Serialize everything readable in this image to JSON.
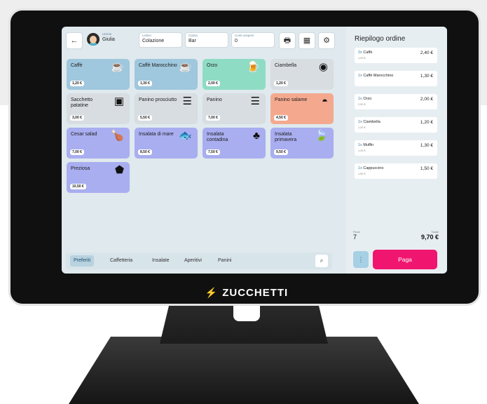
{
  "header": {
    "back_icon": "arrow-left-icon",
    "user": {
      "label": "Utente",
      "value": "Giulia"
    },
    "listino": {
      "label": "Listino",
      "value": "Colazione"
    },
    "cassa": {
      "label": "Cassa",
      "value": "Bar"
    },
    "conti": {
      "label": "Conti sospesi",
      "value": "0"
    },
    "tool_icons": [
      "printer-icon",
      "calculator-icon",
      "gear-icon"
    ],
    "tool_glyphs": [
      "🖶",
      "▦",
      "⚙"
    ]
  },
  "products": [
    {
      "name": "Caffè",
      "price": "1,20 €",
      "icon": "coffee-cup-icon",
      "glyph": "☕",
      "color": "blue"
    },
    {
      "name": "Caffè Marocchino",
      "price": "1,30 €",
      "icon": "coffee-cup-icon",
      "glyph": "☕",
      "color": "blue"
    },
    {
      "name": "Orzo",
      "price": "2,00 €",
      "icon": "mug-icon",
      "glyph": "🍺",
      "color": "green"
    },
    {
      "name": "Ciambella",
      "price": "1,20 €",
      "icon": "donut-icon",
      "glyph": "◉",
      "color": "grey"
    },
    {
      "name": "Sacchetto patatine",
      "price": "3,00 €",
      "icon": "chips-bag-icon",
      "glyph": "▣",
      "color": "grey"
    },
    {
      "name": "Panino prosciutto",
      "price": "5,50 €",
      "icon": "sandwich-icon",
      "glyph": "☰",
      "color": "grey"
    },
    {
      "name": "Panino",
      "price": "7,00 €",
      "icon": "sandwich-icon",
      "glyph": "☰",
      "color": "grey"
    },
    {
      "name": "Panino salame",
      "price": "4,50 €",
      "icon": "taco-icon",
      "glyph": "◓",
      "color": "salmon"
    },
    {
      "name": "Cesar salad",
      "price": "7,00 €",
      "icon": "chicken-leg-icon",
      "glyph": "🍗",
      "color": "purple"
    },
    {
      "name": "Insalata di mare",
      "price": "8,50 €",
      "icon": "fish-icon",
      "glyph": "🐟",
      "color": "purple"
    },
    {
      "name": "Insalata contadina",
      "price": "7,50 €",
      "icon": "broccoli-icon",
      "glyph": "♣",
      "color": "purple"
    },
    {
      "name": "Insalata primavera",
      "price": "9,50 €",
      "icon": "leaf-icon",
      "glyph": "🍃",
      "color": "purple"
    },
    {
      "name": "Preziosa",
      "price": "10,50 €",
      "icon": "vegetable-icon",
      "glyph": "⬟",
      "color": "purple"
    }
  ],
  "categories": {
    "items": [
      "Preferiti",
      "Caffetteria",
      "Insalate",
      "Aperitivi",
      "Panini"
    ],
    "active": "Preferiti",
    "search_icon": "search-icon"
  },
  "order": {
    "title": "Riepilogo ordine",
    "lines": [
      {
        "qty": "2x",
        "name": "Caffè",
        "sub": "1,20 €",
        "price": "2,40 €"
      },
      {
        "qty": "1x",
        "name": "Caffè Marocchino",
        "sub": "",
        "price": "1,30 €"
      },
      {
        "qty": "1x",
        "name": "Orzo",
        "sub": "2,00 €",
        "price": "2,00 €"
      },
      {
        "qty": "1x",
        "name": "Ciambella",
        "sub": "1,20 €",
        "price": "1,20 €"
      },
      {
        "qty": "1x",
        "name": "Muffin",
        "sub": "1,30 €",
        "price": "1,30 €"
      },
      {
        "qty": "1x",
        "name": "Cappuccino",
        "sub": "1,50 €",
        "price": "1,50 €"
      }
    ],
    "pezzi_label": "Pezzi",
    "pezzi_value": "7",
    "totale_label": "Totale",
    "totale_value": "9,70 €",
    "more_icon": "more-vertical-icon",
    "pay_label": "Paga"
  },
  "device": {
    "brand": "ZUCCHETTI",
    "brand_icon": "zucchetti-logo-icon"
  }
}
